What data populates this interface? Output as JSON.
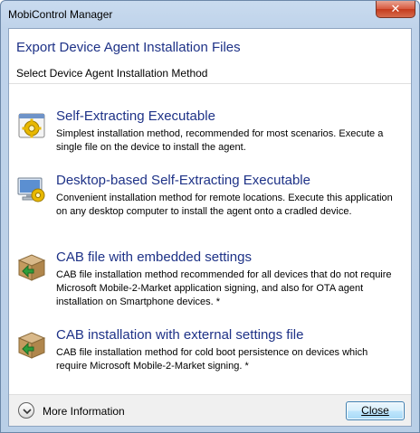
{
  "window": {
    "title": "MobiControl Manager",
    "close_glyph": "✕"
  },
  "header": {
    "title": "Export Device Agent Installation Files",
    "subtitle": "Select Device Agent Installation Method"
  },
  "options": [
    {
      "title": "Self-Extracting Executable",
      "description": "Simplest installation method, recommended for most scenarios. Execute a single file on the device to install the agent.",
      "icon": "gear-exe-icon"
    },
    {
      "title": "Desktop-based Self-Extracting Executable",
      "description": "Convenient installation method for remote locations. Execute this application on any desktop computer to install the agent onto a cradled device.",
      "icon": "desktop-gear-icon"
    },
    {
      "title": "CAB file with embedded settings",
      "description": "CAB file installation method recommended for all devices that do not require Microsoft Mobile-2-Market application signing, and also for OTA agent installation on Smartphone devices. *",
      "icon": "cab-package-icon"
    },
    {
      "title": "CAB installation with external settings file",
      "description": "CAB file installation method for cold boot persistence on devices which require Microsoft Mobile-2-Market signing. *",
      "icon": "cab-package-icon"
    }
  ],
  "footer": {
    "more_info_label": "More Information",
    "close_label": "Close"
  },
  "colors": {
    "link_blue": "#1e3287",
    "frame": "#bfd3ea",
    "footer_bg": "#f0f0f0"
  }
}
